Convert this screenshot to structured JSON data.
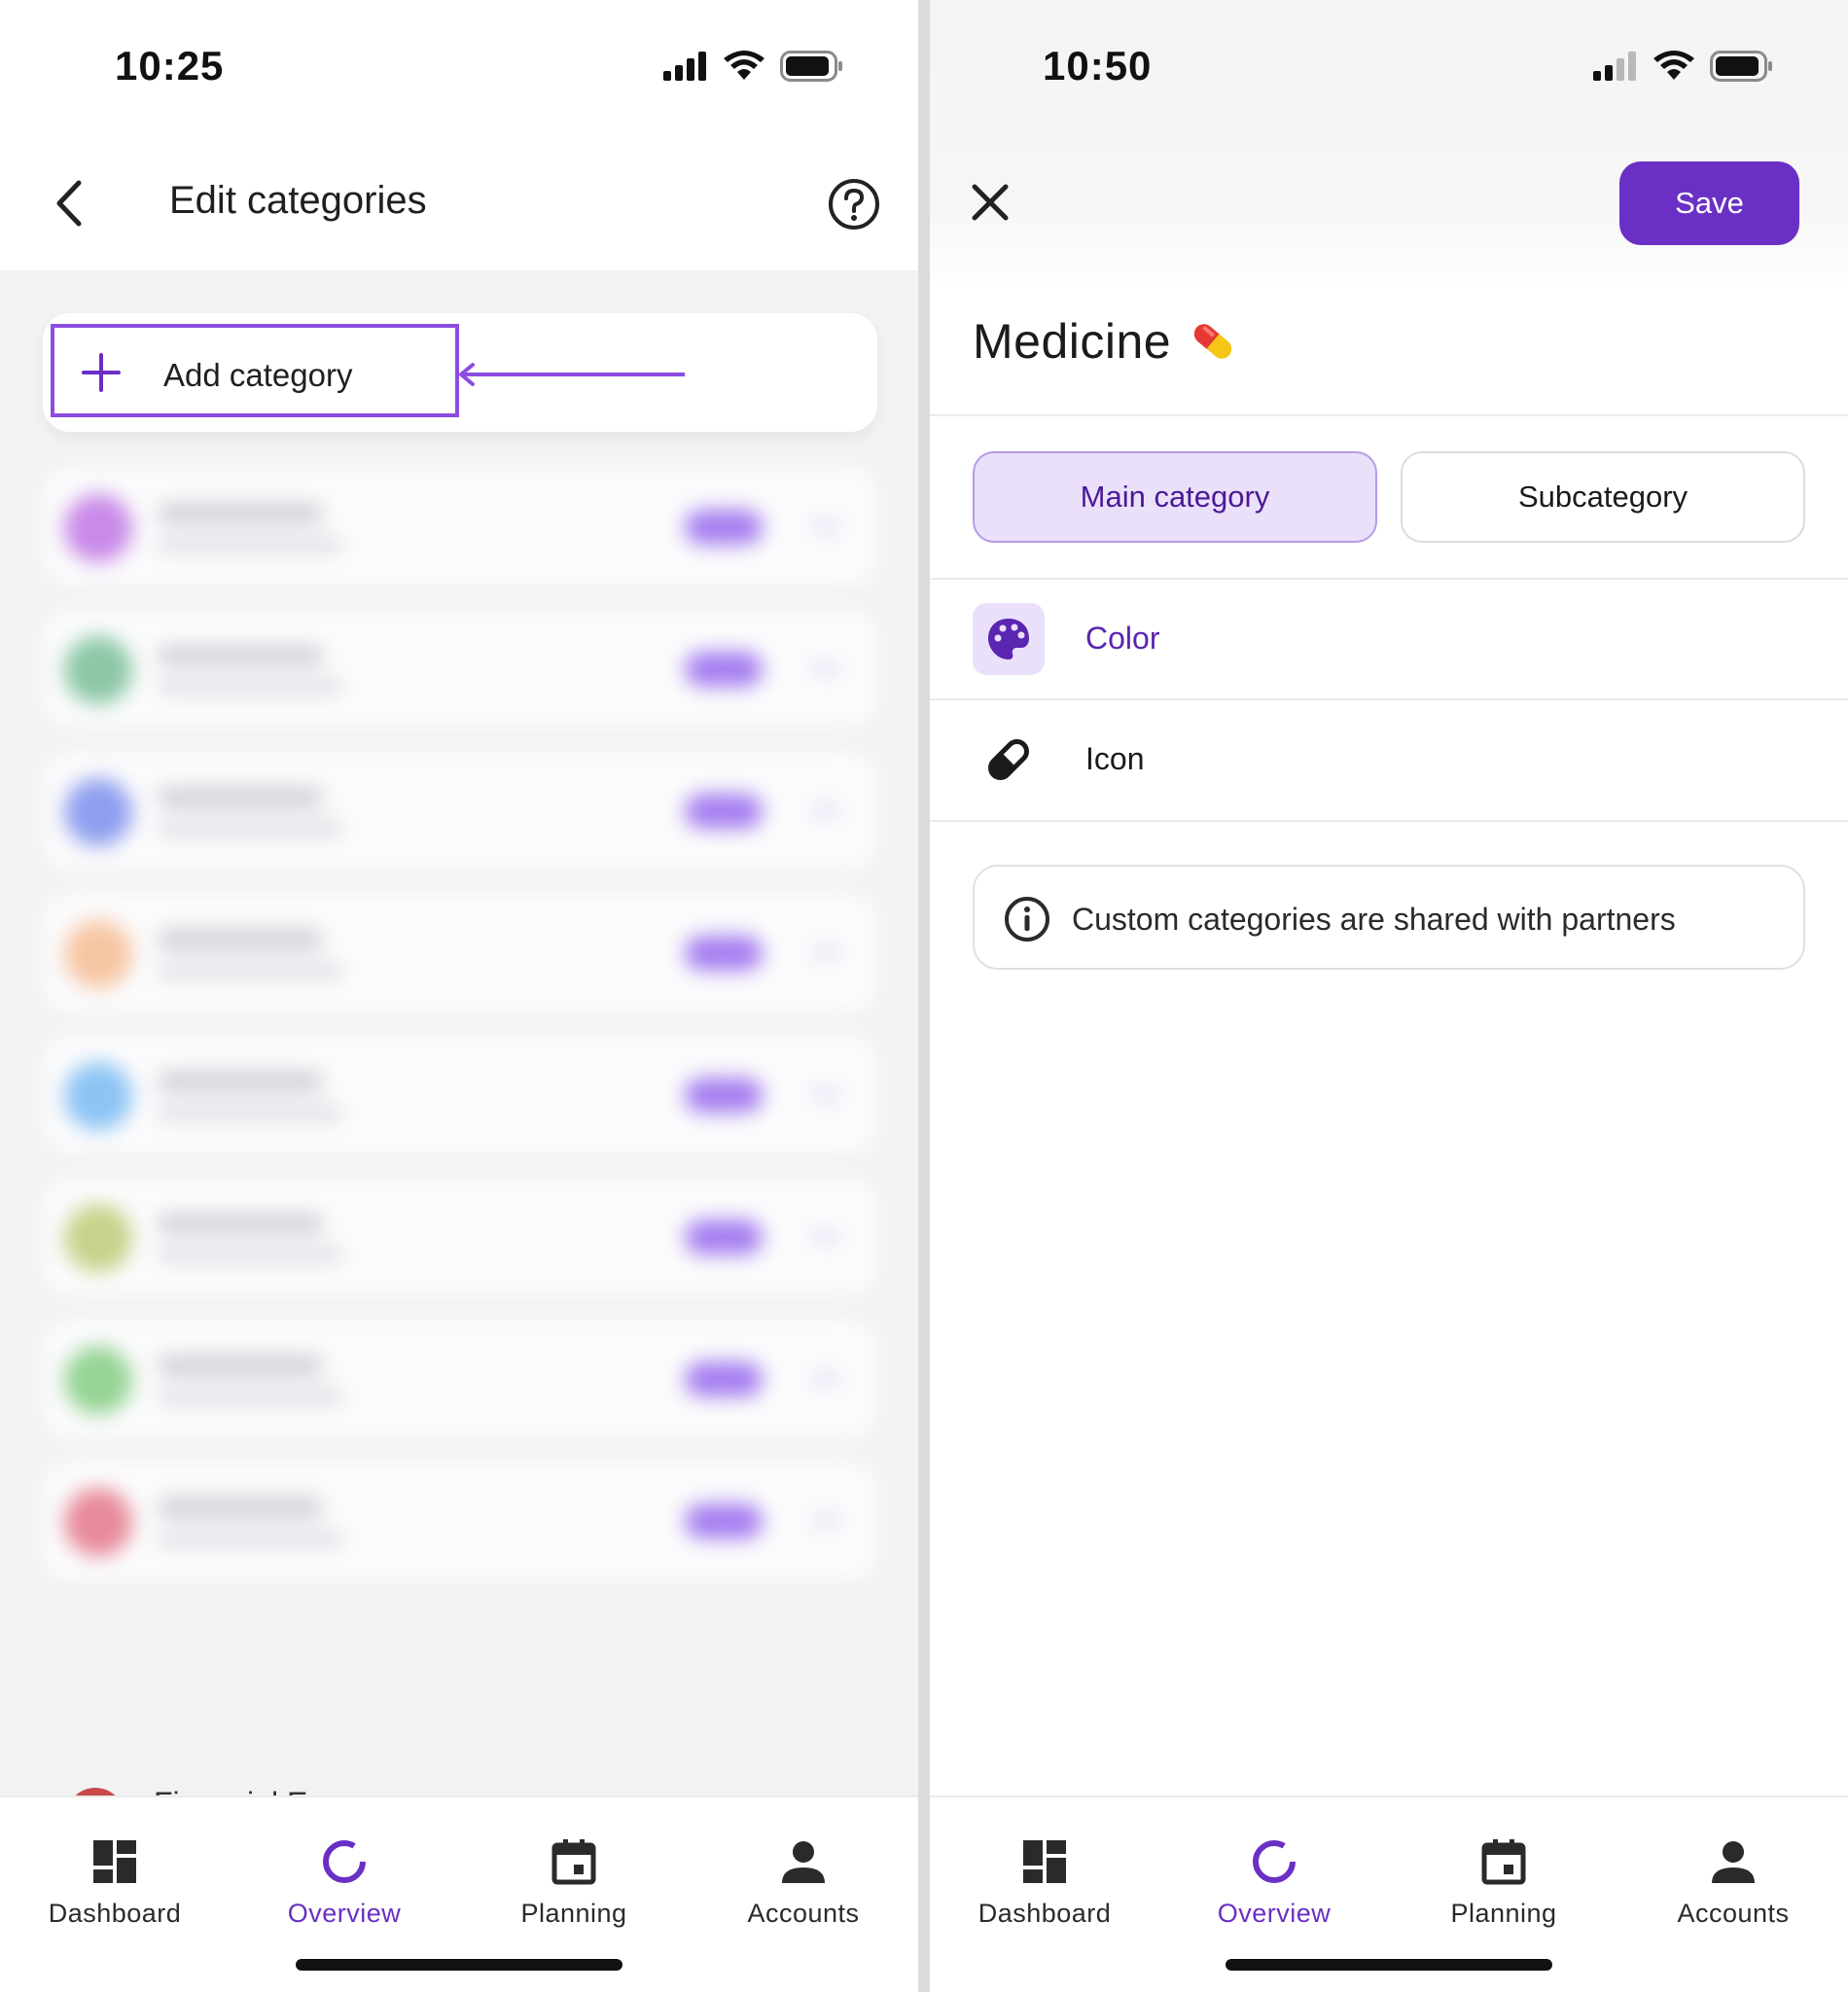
{
  "left": {
    "status_time": "10:25",
    "title": "Edit categories",
    "add_label": "Add category",
    "peek_label": "Financial Expenses",
    "blurred_colors": [
      "#c98ae8",
      "#8cc7a6",
      "#8f9ff0",
      "#f7c6a3",
      "#8cc4f5",
      "#c8d28a",
      "#96d494",
      "#e88a9a"
    ]
  },
  "right": {
    "status_time": "10:50",
    "save_label": "Save",
    "category_name": "Medicine",
    "tabs": [
      "Main category",
      "Subcategory"
    ],
    "color_label": "Color",
    "icon_label": "Icon",
    "info_text": "Custom categories are shared with partners"
  },
  "tabbar": [
    {
      "label": "Dashboard",
      "icon": "dashboard-icon"
    },
    {
      "label": "Overview",
      "icon": "overview-icon",
      "active": true
    },
    {
      "label": "Planning",
      "icon": "calendar-icon"
    },
    {
      "label": "Accounts",
      "icon": "person-icon"
    }
  ],
  "colors": {
    "accent": "#6a2fc4",
    "accent_light": "#ebe0fa",
    "highlight": "#8c4ce2"
  }
}
